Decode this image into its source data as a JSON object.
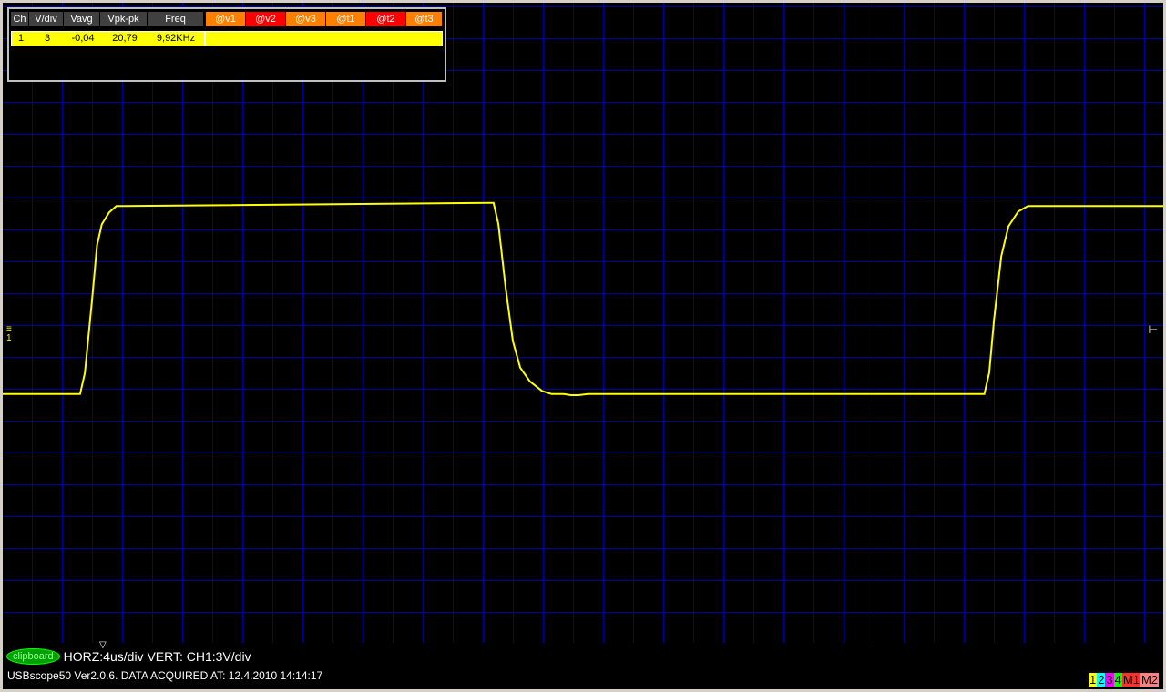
{
  "measurements": {
    "headers": [
      "Ch",
      "V/div",
      "Vavg",
      "Vpk-pk",
      "Freq"
    ],
    "cursor_headers": [
      {
        "label": "@v1",
        "color": "#ff8000"
      },
      {
        "label": "@v2",
        "color": "#ff0000"
      },
      {
        "label": "@v3",
        "color": "#ff8000"
      },
      {
        "label": "@t1",
        "color": "#ff8000"
      },
      {
        "label": "@t2",
        "color": "#ff0000"
      },
      {
        "label": "@t3",
        "color": "#ff8000"
      }
    ],
    "row": {
      "ch": "1",
      "vdiv": "3",
      "vavg": "-0,04",
      "vpkpk": "20,79",
      "freq": "9,92KHz"
    }
  },
  "status": {
    "clipboard_label": "clipboard",
    "horz_vert": "HORZ:4us/div VERT: CH1:3V/div",
    "version_line": "USBscope50 Ver2.0.6.  DATA ACQUIRED AT: 12.4.2010 14:14:17"
  },
  "channel_indicators": [
    {
      "label": "1",
      "color": "#ffff00"
    },
    {
      "label": "2",
      "color": "#00ffff"
    },
    {
      "label": "3",
      "color": "#ff00ff"
    },
    {
      "label": "4",
      "color": "#00ff00"
    },
    {
      "label": "M1",
      "color": "#ff3030"
    },
    {
      "label": "M2",
      "color": "#ff8080"
    }
  ],
  "markers": {
    "ground_icon": "ground-marker-icon",
    "trigger_icon": "trigger-level-icon",
    "t0_icon": "trigger-time-icon"
  },
  "colors": {
    "grid": "#0000a0",
    "trace": "#ffff00",
    "background": "#000000"
  },
  "chart_data": {
    "type": "line",
    "xlabel": "",
    "ylabel": "",
    "x_unit": "us",
    "y_unit": "V",
    "xlim": [
      0,
      48
    ],
    "ylim": [
      -21,
      21
    ],
    "series": [
      {
        "x": [
          0,
          3.2,
          3.4,
          3.7,
          3.9,
          4.1,
          4.4,
          4.7,
          5.0,
          20.1,
          20.3,
          20.5,
          20.8,
          21.1,
          21.4,
          21.8,
          22.3,
          22.7,
          23.2,
          23.5,
          23.8,
          24.2,
          40.6,
          40.8,
          41.0,
          41.3,
          41.6,
          42.0,
          42.4,
          43.1,
          48
        ],
        "y": [
          -6.5,
          -6.5,
          -4.5,
          2.5,
          7.5,
          9.5,
          10.6,
          11.2,
          11.2,
          11.5,
          11.5,
          9.5,
          3.5,
          -1.5,
          -4.0,
          -5.3,
          -6.2,
          -6.5,
          -6.5,
          -6.6,
          -6.6,
          -6.5,
          -6.5,
          -4.5,
          0.5,
          6.5,
          9.3,
          10.7,
          11.2,
          11.2,
          11.2
        ]
      }
    ]
  }
}
